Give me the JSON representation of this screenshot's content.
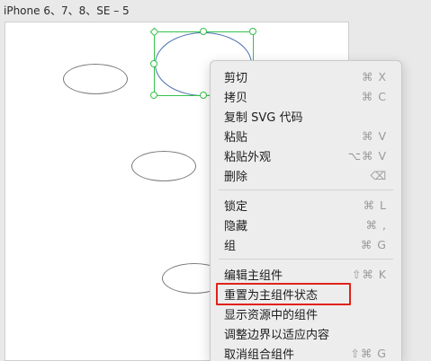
{
  "canvas": {
    "frame_label": "iPhone 6、7、8、SE – 5"
  },
  "context_menu": {
    "items": [
      {
        "label": "剪切",
        "shortcut": "⌘ X"
      },
      {
        "label": "拷贝",
        "shortcut": "⌘ C"
      },
      {
        "label": "复制 SVG 代码",
        "shortcut": ""
      },
      {
        "label": "粘贴",
        "shortcut": "⌘ V"
      },
      {
        "label": "粘贴外观",
        "shortcut": "⌥⌘ V"
      },
      {
        "label": "删除",
        "shortcut": "⌫"
      },
      {
        "label": "锁定",
        "shortcut": "⌘ L"
      },
      {
        "label": "隐藏",
        "shortcut": "⌘ ,"
      },
      {
        "label": "组",
        "shortcut": "⌘ G"
      },
      {
        "label": "编辑主组件",
        "shortcut": "⇧⌘ K"
      },
      {
        "label": "重置为主组件状态",
        "shortcut": ""
      },
      {
        "label": "显示资源中的组件",
        "shortcut": ""
      },
      {
        "label": "调整边界以适应内容",
        "shortcut": ""
      },
      {
        "label": "取消组合组件",
        "shortcut": "⇧⌘ G"
      }
    ]
  },
  "colors": {
    "selection": "#34c24a",
    "highlight": "#e0221b"
  }
}
